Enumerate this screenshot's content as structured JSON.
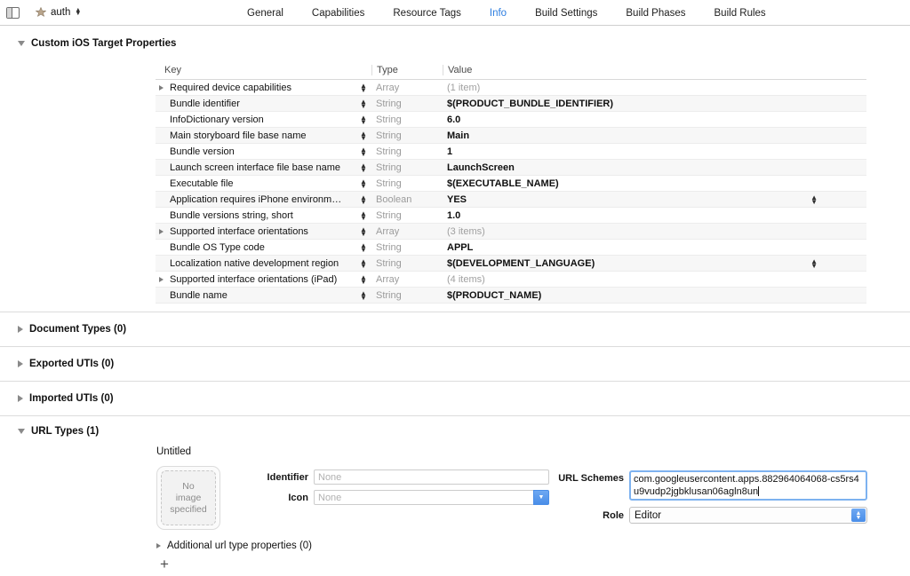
{
  "toolbar": {
    "pane_toggle_name": "navigator-toggle",
    "target_label": "auth",
    "tabs": [
      {
        "label": "General",
        "active": false
      },
      {
        "label": "Capabilities",
        "active": false
      },
      {
        "label": "Resource Tags",
        "active": false
      },
      {
        "label": "Info",
        "active": true
      },
      {
        "label": "Build Settings",
        "active": false
      },
      {
        "label": "Build Phases",
        "active": false
      },
      {
        "label": "Build Rules",
        "active": false
      }
    ]
  },
  "custom_properties": {
    "section_title": "Custom iOS Target Properties",
    "columns": {
      "key": "Key",
      "type": "Type",
      "value": "Value"
    },
    "rows": [
      {
        "key": "Required device capabilities",
        "type": "Array",
        "value": "(1 item)",
        "muted": true,
        "disclosure": true,
        "row_stepper": false
      },
      {
        "key": "Bundle identifier",
        "type": "String",
        "value": "$(PRODUCT_BUNDLE_IDENTIFIER)",
        "muted": false,
        "disclosure": false,
        "row_stepper": false
      },
      {
        "key": "InfoDictionary version",
        "type": "String",
        "value": "6.0",
        "muted": false,
        "disclosure": false,
        "row_stepper": false
      },
      {
        "key": "Main storyboard file base name",
        "type": "String",
        "value": "Main",
        "muted": false,
        "disclosure": false,
        "row_stepper": false
      },
      {
        "key": "Bundle version",
        "type": "String",
        "value": "1",
        "muted": false,
        "disclosure": false,
        "row_stepper": false
      },
      {
        "key": "Launch screen interface file base name",
        "type": "String",
        "value": "LaunchScreen",
        "muted": false,
        "disclosure": false,
        "row_stepper": false
      },
      {
        "key": "Executable file",
        "type": "String",
        "value": "$(EXECUTABLE_NAME)",
        "muted": false,
        "disclosure": false,
        "row_stepper": false
      },
      {
        "key": "Application requires iPhone environm…",
        "type": "Boolean",
        "value": "YES",
        "muted": false,
        "disclosure": false,
        "row_stepper": true
      },
      {
        "key": "Bundle versions string, short",
        "type": "String",
        "value": "1.0",
        "muted": false,
        "disclosure": false,
        "row_stepper": false
      },
      {
        "key": "Supported interface orientations",
        "type": "Array",
        "value": "(3 items)",
        "muted": true,
        "disclosure": true,
        "row_stepper": false
      },
      {
        "key": "Bundle OS Type code",
        "type": "String",
        "value": "APPL",
        "muted": false,
        "disclosure": false,
        "row_stepper": false
      },
      {
        "key": "Localization native development region",
        "type": "String",
        "value": "$(DEVELOPMENT_LANGUAGE)",
        "muted": false,
        "disclosure": false,
        "row_stepper": true
      },
      {
        "key": "Supported interface orientations (iPad)",
        "type": "Array",
        "value": "(4 items)",
        "muted": true,
        "disclosure": true,
        "row_stepper": false
      },
      {
        "key": "Bundle name",
        "type": "String",
        "value": "$(PRODUCT_NAME)",
        "muted": false,
        "disclosure": false,
        "row_stepper": false
      }
    ]
  },
  "collapsed_sections": [
    {
      "title": "Document Types (0)"
    },
    {
      "title": "Exported UTIs (0)"
    },
    {
      "title": "Imported UTIs (0)"
    }
  ],
  "url_types": {
    "section_title": "URL Types (1)",
    "entry_name": "Untitled",
    "image_well_text": "No\nimage\nspecified",
    "image_well_line1": "No",
    "image_well_line2": "image",
    "image_well_line3": "specified",
    "identifier_label": "Identifier",
    "identifier_value": "",
    "identifier_placeholder": "None",
    "icon_label": "Icon",
    "icon_value": "",
    "icon_placeholder": "None",
    "url_schemes_label": "URL Schemes",
    "url_schemes_value": "com.googleusercontent.apps.882964064068-cs5rs4u9vudp2jgbklusan06agln8un",
    "role_label": "Role",
    "role_value": "Editor",
    "additional_props_label": "Additional url type properties (0)",
    "add_button_label": "+"
  },
  "colors": {
    "accent_blue": "#2b7de0",
    "control_blue": "#4a8ee8",
    "focus_ring": "#7db2f0",
    "row_alt": "#f7f7f7",
    "muted_text": "#9b9b9b"
  }
}
